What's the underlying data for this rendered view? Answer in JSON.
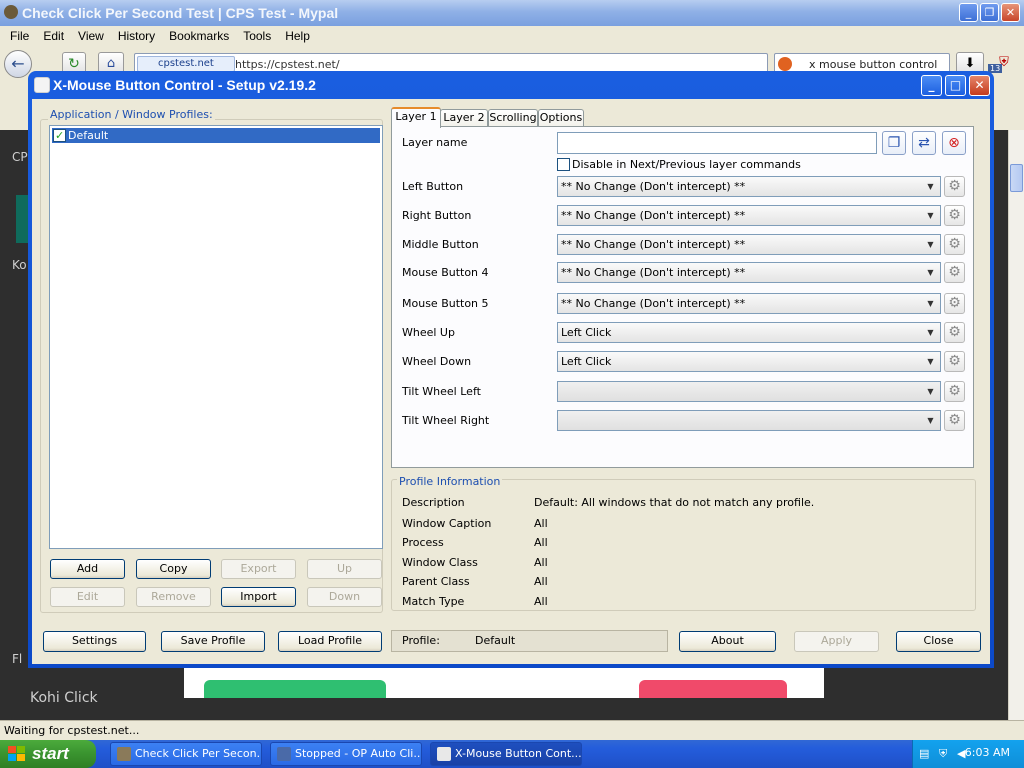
{
  "browser": {
    "title": "Check Click Per Second Test | CPS Test - Mypal",
    "menu": [
      "File",
      "Edit",
      "View",
      "History",
      "Bookmarks",
      "Tools",
      "Help"
    ],
    "site_badge": "cpstest.net",
    "url": "https://cpstest.net/",
    "search_text": "x mouse button control",
    "ext_badge": "13",
    "page_text_1": "CP",
    "page_text_2": "Ko",
    "page_text_3": "Fl",
    "page_kohi": "Kohi Click",
    "status": "Waiting for cpstest.net..."
  },
  "dialog": {
    "title": "X-Mouse Button Control - Setup v2.19.2",
    "profiles_label": "Application / Window Profiles:",
    "profiles": [
      {
        "name": "Default",
        "checked": true
      }
    ],
    "profile_buttons": {
      "add": "Add",
      "copy": "Copy",
      "export": "Export",
      "up": "Up",
      "edit": "Edit",
      "remove": "Remove",
      "import": "Import",
      "down": "Down"
    },
    "tabs": [
      "Layer 1",
      "Layer 2",
      "Scrolling",
      "Options"
    ],
    "layer_name_label": "Layer name",
    "layer_name_value": "",
    "disable_label": "Disable in Next/Previous layer commands",
    "mappings": [
      {
        "label": "Left Button",
        "value": "** No Change (Don't intercept) **"
      },
      {
        "label": "Right Button",
        "value": "** No Change (Don't intercept) **"
      },
      {
        "label": "Middle Button",
        "value": "** No Change (Don't intercept) **"
      },
      {
        "label": "Mouse Button 4",
        "value": "** No Change (Don't intercept) **"
      },
      {
        "label": "Mouse Button 5",
        "value": "** No Change (Don't intercept) **"
      },
      {
        "label": "Wheel Up",
        "value": "Left Click"
      },
      {
        "label": "Wheel Down",
        "value": "Left Click"
      },
      {
        "label": "Tilt Wheel Left",
        "value": ""
      },
      {
        "label": "Tilt Wheel Right",
        "value": ""
      }
    ],
    "profile_info": {
      "title": "Profile Information",
      "rows": [
        {
          "label": "Description",
          "value": "Default: All windows that do not match any profile."
        },
        {
          "label": "Window Caption",
          "value": "All"
        },
        {
          "label": "Process",
          "value": "All"
        },
        {
          "label": "Window Class",
          "value": "All"
        },
        {
          "label": "Parent Class",
          "value": "All"
        },
        {
          "label": "Match Type",
          "value": "All"
        }
      ]
    },
    "bottom": {
      "settings": "Settings",
      "save_profile": "Save Profile",
      "load_profile": "Load Profile",
      "profile_label": "Profile:",
      "profile_value": "Default",
      "about": "About",
      "apply": "Apply",
      "close": "Close"
    }
  },
  "taskbar": {
    "start": "start",
    "tasks": [
      {
        "label": "Check Click Per Secon...",
        "active": false
      },
      {
        "label": "Stopped - OP Auto Cli...",
        "active": false
      },
      {
        "label": "X-Mouse Button Cont...",
        "active": true
      }
    ],
    "time": "6:03 AM"
  },
  "colors": {
    "xp_blue": "#0c49c8",
    "dialog_face": "#ece9d8",
    "group_label": "#1d4fb0",
    "selection": "#316ac5",
    "start_green": "#3b9530"
  }
}
